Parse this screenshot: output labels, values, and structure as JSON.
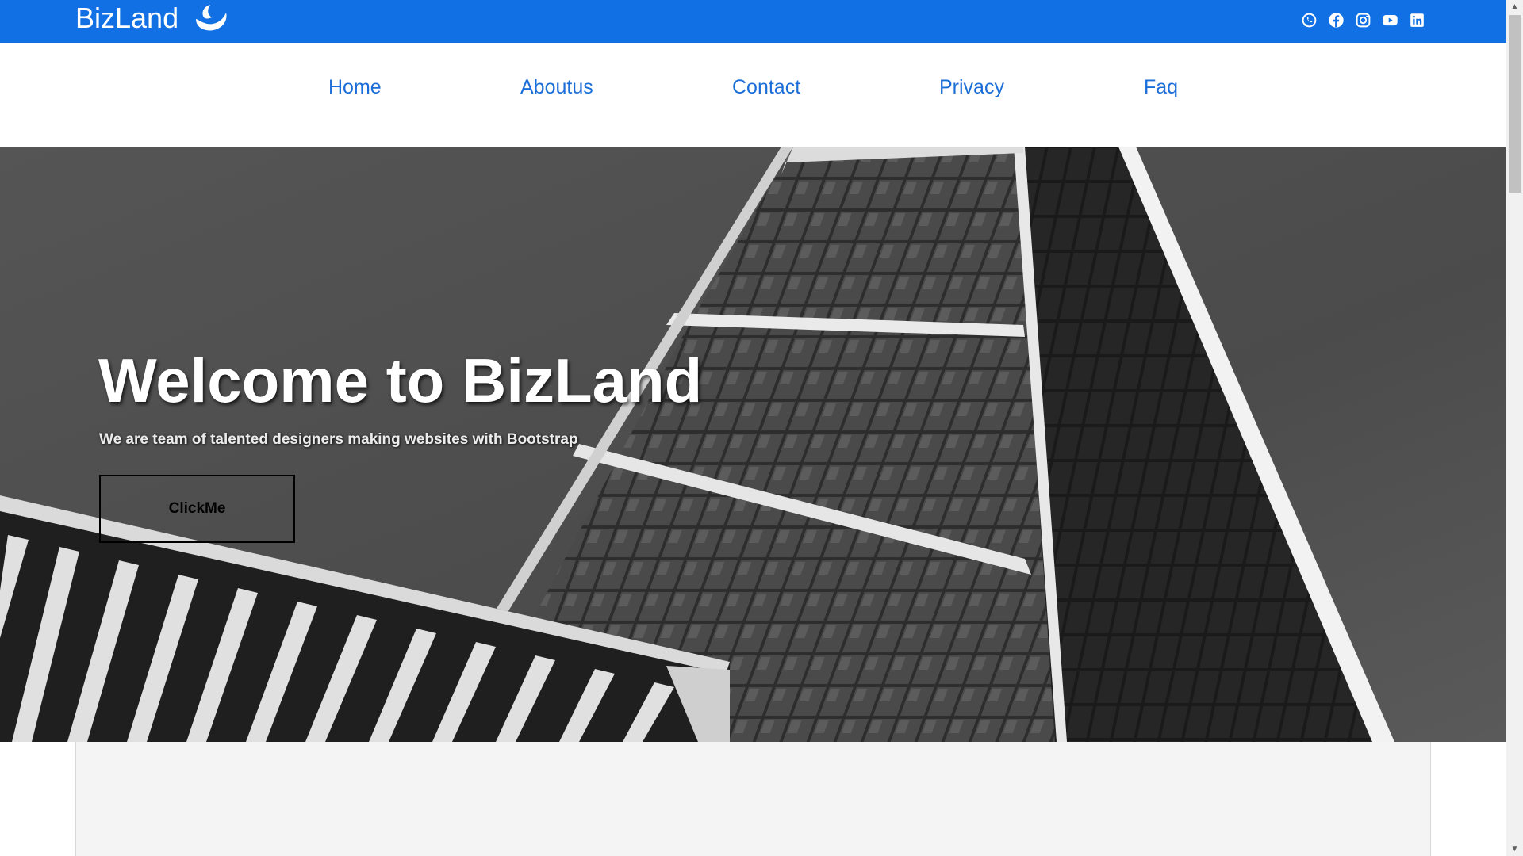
{
  "brand": {
    "name": "BizLand",
    "logo_icon": "crescent-logo-icon"
  },
  "social_icons": [
    "whatsapp-icon",
    "facebook-icon",
    "instagram-icon",
    "youtube-icon",
    "linkedin-icon"
  ],
  "nav": {
    "items": [
      {
        "label": "Home"
      },
      {
        "label": "Aboutus"
      },
      {
        "label": "Contact"
      },
      {
        "label": "Privacy"
      },
      {
        "label": "Faq"
      }
    ]
  },
  "hero": {
    "title": "Welcome to BizLand",
    "subtitle": "We are team of talented designers making websites with Bootstrap",
    "button_label": "ClickMe"
  },
  "colors": {
    "topbar": "#1170e4",
    "nav_link": "#1b6ed8",
    "content_bg": "#f4f4f4"
  }
}
